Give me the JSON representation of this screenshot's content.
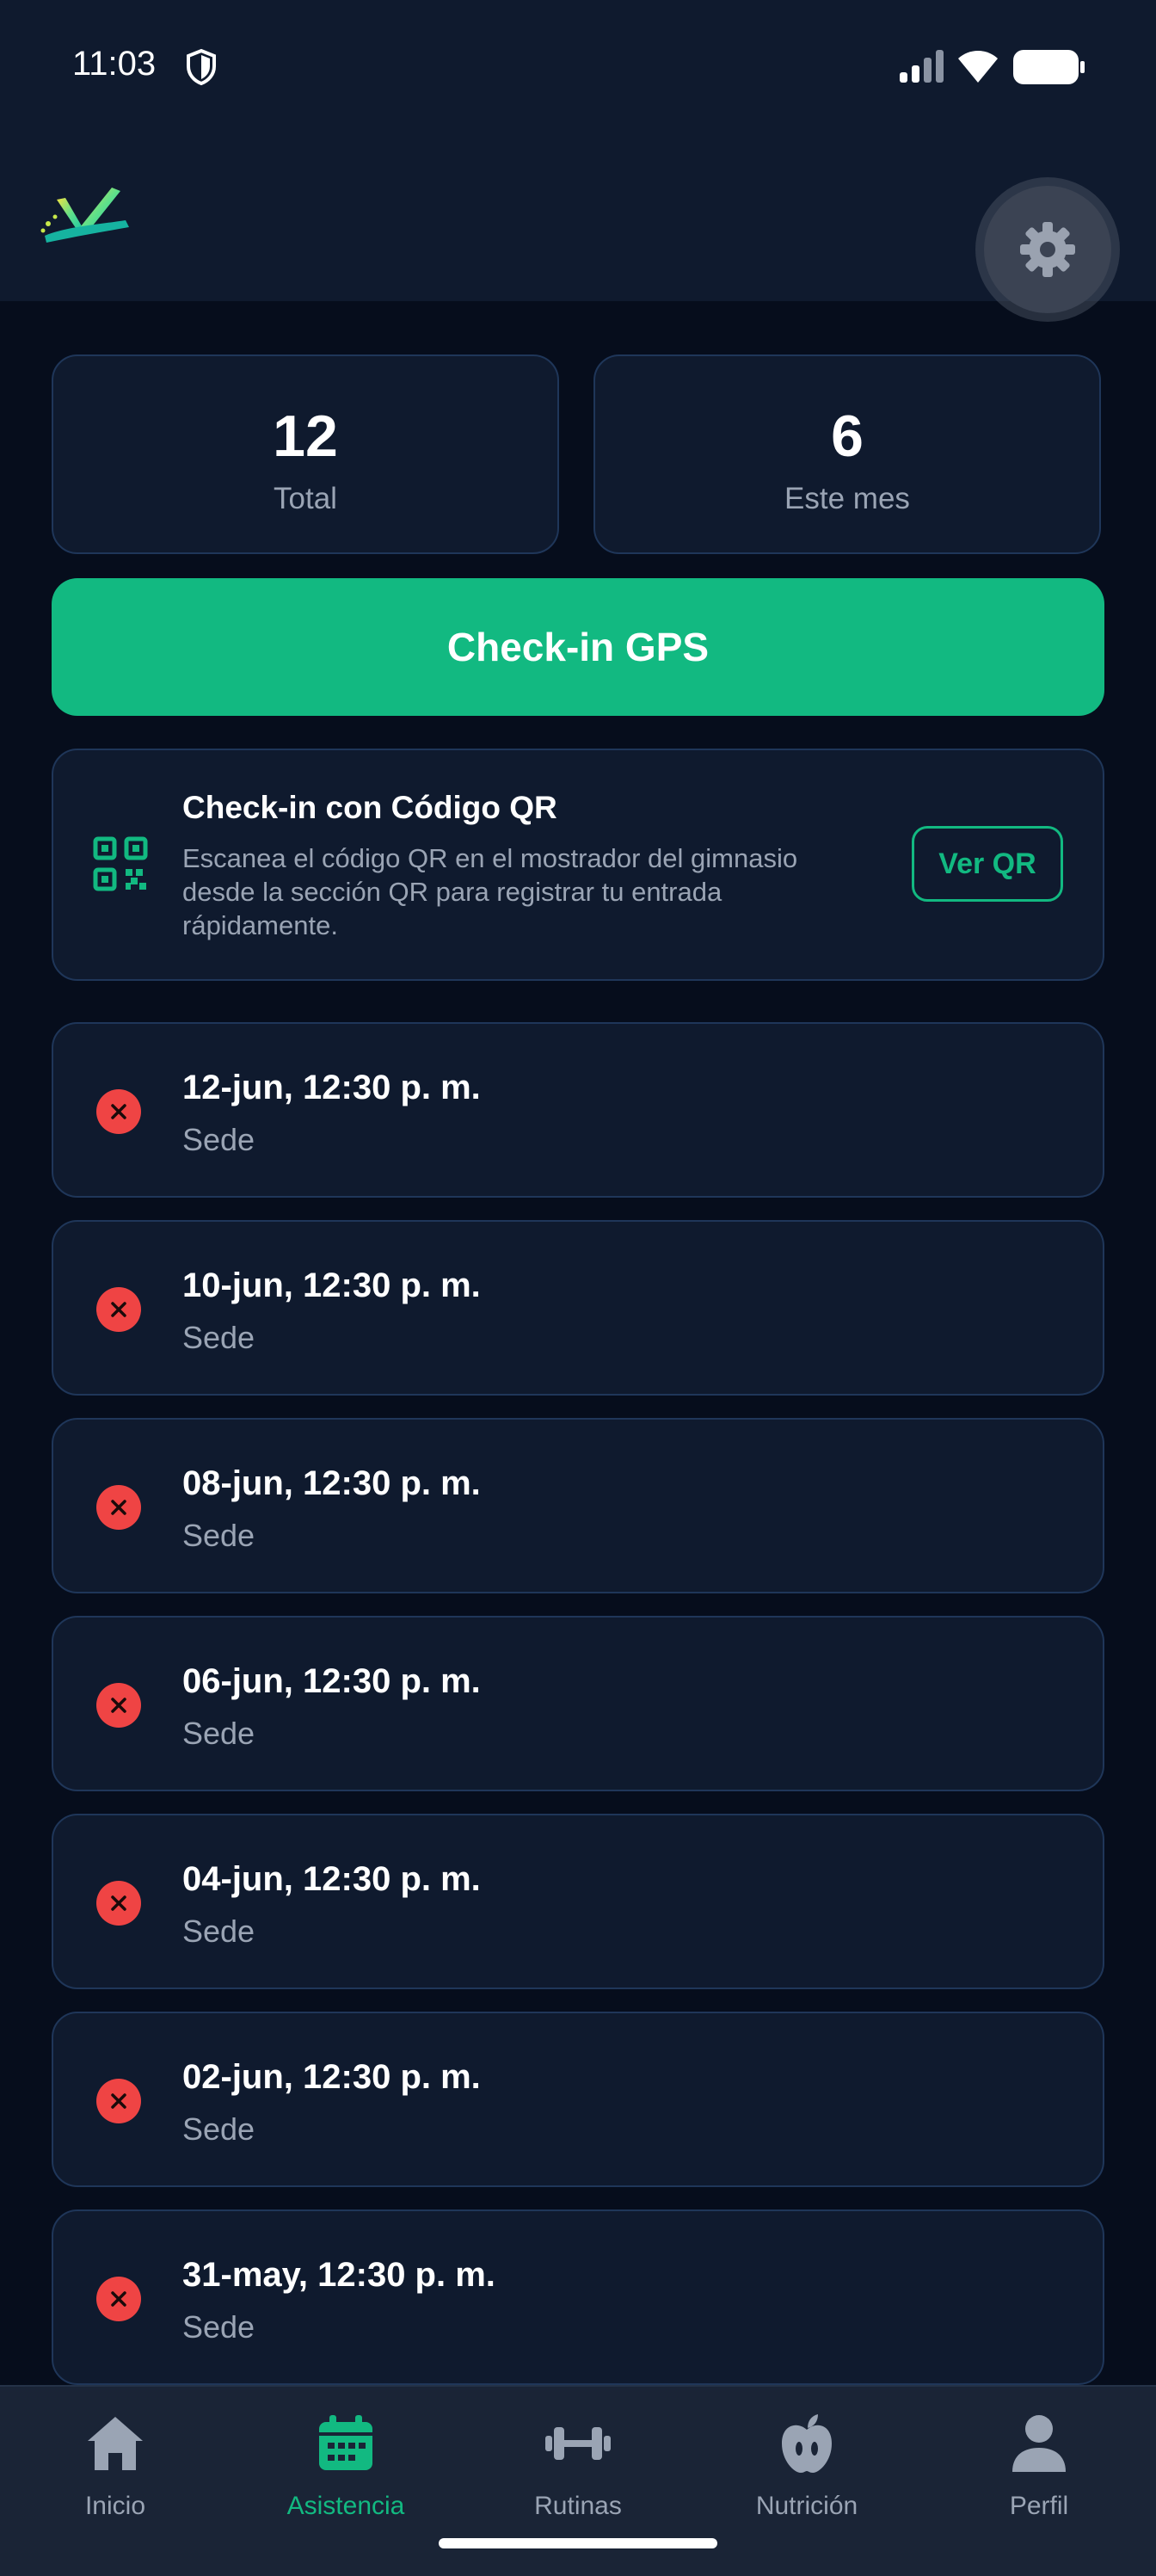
{
  "status_bar": {
    "time": "11:03"
  },
  "stats": [
    {
      "value": "12",
      "label": "Total"
    },
    {
      "value": "6",
      "label": "Este mes"
    }
  ],
  "gps_button": {
    "label": "Check-in GPS"
  },
  "qr_card": {
    "title": "Check-in con Código QR",
    "description": "Escanea el código QR en el mostrador del gimnasio desde la sección QR para registrar tu entrada rápidamente.",
    "button_label": "Ver QR"
  },
  "attendance": [
    {
      "date": "12-jun, 12:30 p. m.",
      "location": "Sede",
      "status": "failed"
    },
    {
      "date": "10-jun, 12:30 p. m.",
      "location": "Sede",
      "status": "failed"
    },
    {
      "date": "08-jun, 12:30 p. m.",
      "location": "Sede",
      "status": "failed"
    },
    {
      "date": "06-jun, 12:30 p. m.",
      "location": "Sede",
      "status": "failed"
    },
    {
      "date": "04-jun, 12:30 p. m.",
      "location": "Sede",
      "status": "failed"
    },
    {
      "date": "02-jun, 12:30 p. m.",
      "location": "Sede",
      "status": "failed"
    },
    {
      "date": "31-may, 12:30 p. m.",
      "location": "Sede",
      "status": "failed"
    }
  ],
  "nav": [
    {
      "label": "Inicio",
      "icon": "home-icon",
      "active": false
    },
    {
      "label": "Asistencia",
      "icon": "calendar-icon",
      "active": true
    },
    {
      "label": "Rutinas",
      "icon": "dumbbell-icon",
      "active": false
    },
    {
      "label": "Nutrición",
      "icon": "apple-icon",
      "active": false
    },
    {
      "label": "Perfil",
      "icon": "user-icon",
      "active": false
    }
  ],
  "colors": {
    "accent": "#12b981",
    "error": "#ef4444",
    "background": "#060d1c",
    "card": "#0f1a2e"
  }
}
